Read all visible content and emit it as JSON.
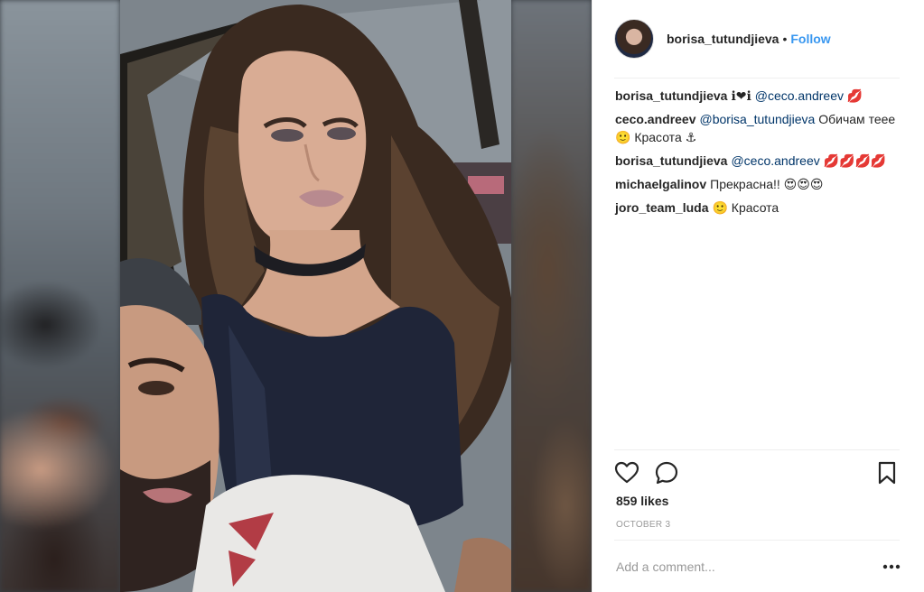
{
  "post": {
    "author": "borisa_tutundjieva",
    "separator": "•",
    "follow_label": "Follow"
  },
  "comments": [
    {
      "user": "borisa_tutundjieva",
      "text": "ℹ❤ℹ",
      "mention": "@ceco.andreev",
      "tail": "💋"
    },
    {
      "user": "ceco.andreev",
      "mention": "@borisa_tutundjieva",
      "text": "Обичам теее 🙂 Красота ⚓"
    },
    {
      "user": "borisa_tutundjieva",
      "mention": "@ceco.andreev",
      "text": "💋💋💋💋"
    },
    {
      "user": "michaelgalinov",
      "text": "Прекрасна!! 😍😍😍"
    },
    {
      "user": "joro_team_luda",
      "text": "🙂 Красота"
    }
  ],
  "likes": "859 likes",
  "date": "OCTOBER 3",
  "add_comment_placeholder": "Add a comment...",
  "icons": {
    "like": "heart-icon",
    "comment": "comment-bubble-icon",
    "save": "bookmark-icon",
    "more": "more-options-icon"
  },
  "colors": {
    "link": "#3897f0",
    "text": "#262626",
    "muted": "#999999",
    "divider": "#efefef"
  }
}
